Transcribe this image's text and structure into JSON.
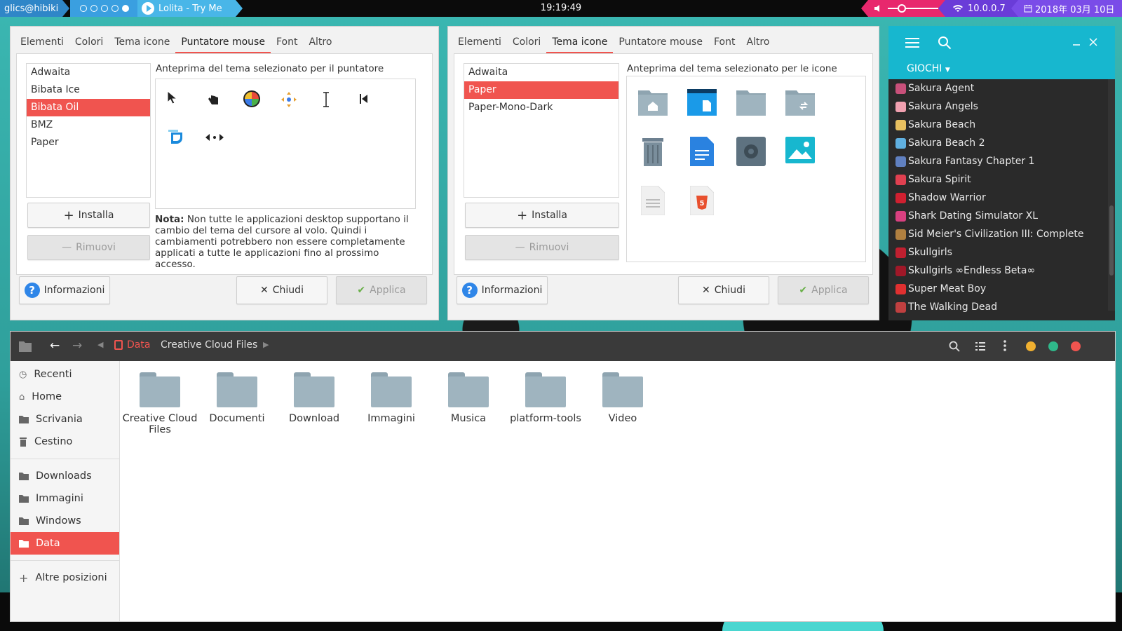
{
  "topbar": {
    "user": "glics@hibiki",
    "media_title": "Lolita - Try Me",
    "clock": "19:19:49",
    "network": "10.0.0.7",
    "date": "2018年 03月 10日"
  },
  "dialog_left": {
    "tabs": [
      "Elementi",
      "Colori",
      "Tema icone",
      "Puntatore mouse",
      "Font",
      "Altro"
    ],
    "active_tab": "Puntatore mouse",
    "themes": [
      "Adwaita",
      "Bibata Ice",
      "Bibata Oil",
      "BMZ",
      "Paper"
    ],
    "selected_theme": "Bibata Oil",
    "preview_label": "Anteprima del tema selezionato per il puntatore",
    "install_label": "Installa",
    "remove_label": "Rimuovi",
    "note_bold": "Nota:",
    "note_text": " Non tutte le applicazioni desktop supportano il cambio del tema del cursore al volo. Quindi i cambiamenti potrebbero non essere completamente applicati a tutte le applicazioni fino al prossimo accesso.",
    "info_label": "Informazioni",
    "close_label": "Chiudi",
    "apply_label": "Applica"
  },
  "dialog_right": {
    "tabs": [
      "Elementi",
      "Colori",
      "Tema icone",
      "Puntatore mouse",
      "Font",
      "Altro"
    ],
    "active_tab": "Tema icone",
    "themes": [
      "Adwaita",
      "Paper",
      "Paper-Mono-Dark"
    ],
    "selected_theme": "Paper",
    "preview_label": "Anteprima del tema selezionato per le icone",
    "install_label": "Installa",
    "remove_label": "Rimuovi",
    "info_label": "Informazioni",
    "close_label": "Chiudi",
    "apply_label": "Applica"
  },
  "games": {
    "category": "GIOCHI",
    "items": [
      {
        "name": "Sakura Agent",
        "color": "#c8507a"
      },
      {
        "name": "Sakura Angels",
        "color": "#f0a0b0"
      },
      {
        "name": "Sakura Beach",
        "color": "#e8c060"
      },
      {
        "name": "Sakura Beach 2",
        "color": "#60b0e0"
      },
      {
        "name": "Sakura Fantasy Chapter 1",
        "color": "#6080c0"
      },
      {
        "name": "Sakura Spirit",
        "color": "#e04050"
      },
      {
        "name": "Shadow Warrior",
        "color": "#d02030"
      },
      {
        "name": "Shark Dating Simulator XL",
        "color": "#d84080"
      },
      {
        "name": "Sid Meier's Civilization III: Complete",
        "color": "#b08040"
      },
      {
        "name": "Skullgirls",
        "color": "#c02030"
      },
      {
        "name": "Skullgirls ∞Endless Beta∞",
        "color": "#a01828"
      },
      {
        "name": "Super Meat Boy",
        "color": "#e03030"
      },
      {
        "name": "The Walking Dead",
        "color": "#c04040"
      }
    ]
  },
  "file_manager": {
    "breadcrumb_current": "Data",
    "breadcrumb_next": "Creative Cloud Files",
    "sidebar": {
      "places": [
        "Recenti",
        "Home",
        "Scrivania",
        "Cestino"
      ],
      "bookmarks": [
        "Downloads",
        "Immagini",
        "Windows",
        "Data"
      ],
      "selected": "Data",
      "other": "Altre posizioni"
    },
    "folders": [
      "Creative Cloud Files",
      "Documenti",
      "Download",
      "Immagini",
      "Musica",
      "platform-tools",
      "Video"
    ]
  },
  "colors": {
    "accent": "#f0544f",
    "games_header": "#17b7cf"
  }
}
